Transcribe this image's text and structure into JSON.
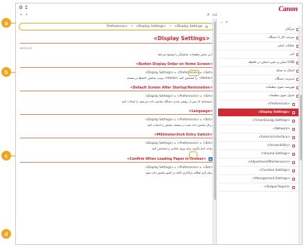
{
  "callouts": {
    "a": "a",
    "b": "b",
    "c": "c",
    "d": "d"
  },
  "toolbar": {
    "logo": "Canon",
    "doc_code": "80YY-072"
  },
  "breadcrumb": {
    "items": [
      "Preferences>",
      "<Display Settings>",
      "<Display Settings"
    ]
  },
  "page": {
    "title": "<Display Settings>",
    "intro": "این بخش تنظیمات نمایشگر را توضیح می‌دهد."
  },
  "sections": [
    {
      "head": "<Button Display Order on Home Screen>",
      "path": [
        "<Set>",
        "<Preferences>",
        "<Display Settings>"
      ],
      "body": "ترتیب نمایش دکمه‌ها در صفحه <Home> را مشخص کنید. <Home>"
    },
    {
      "head": "<Default Screen After Startup/Restoration>",
      "path": [
        "<Set>",
        "<Preferences>",
        "<Display Settings>"
      ],
      "body": "صفحه‌ای که پس از روشن شدن دستگاه نمایش داده می‌شود را انتخاب کنید."
    },
    {
      "head": "<Language>",
      "path": [
        "<Set>",
        "<Preferences>",
        "<Display Settings>"
      ],
      "body": "زبان نمایش داده شده در صفحه نمایش را انتخاب کنید."
    },
    {
      "head": "<Millimeter/Inch Entry Switch>",
      "path": [
        "<Set>",
        "<Preferences>",
        "<Display Settings>"
      ],
      "body": "واحد اندازه‌گیری برای ورود مقادیر را مشخص کنید."
    }
  ],
  "collapsible": {
    "label": "<Confirm When Loading Paper in Drawer>",
    "path": [
      "<Set>",
      "<Preferences>",
      "<Display Settings>"
    ],
    "body": "پیام تأیید هنگام بارگذاری کاغذ در کشو نمایش داده شود."
  },
  "sidebar": {
    "items": [
      {
        "label": "سرآغاز",
        "sub": false,
        "active": false
      },
      {
        "label": "سرعت کار با دستگاه",
        "sub": false,
        "active": false
      },
      {
        "label": "عملیات اصلی",
        "sub": false,
        "active": false
      },
      {
        "label": "کپی",
        "sub": false,
        "active": false
      },
      {
        "label": "اسکن و ذخیره اسکن در حافظه USB",
        "sub": false,
        "active": false
      },
      {
        "label": "اتصال به شبکه",
        "sub": false,
        "active": false
      },
      {
        "label": "مدیریت دستگاه",
        "sub": false,
        "active": false
      },
      {
        "label": "فهرست منوی تنظیمات",
        "sub": false,
        "active": false
      },
      {
        "label": "جدول منوی تنظیمات",
        "sub": false,
        "active": false
      },
      {
        "label": "<Preferences>",
        "sub": true,
        "active": false
      },
      {
        "label": "<Display Settings>",
        "sub": true,
        "active": true
      },
      {
        "label": "<Timer/Energy Settings>",
        "sub": true,
        "active": false
      },
      {
        "label": "<Network>",
        "sub": true,
        "active": false
      },
      {
        "label": "<External Interface>",
        "sub": true,
        "active": false
      },
      {
        "label": "<Accessibility>",
        "sub": true,
        "active": false
      },
      {
        "label": "<Volume Settings>",
        "sub": true,
        "active": false
      },
      {
        "label": "<Adjustment/Maintenance>",
        "sub": true,
        "active": false
      },
      {
        "label": "<Function Settings>",
        "sub": true,
        "active": false
      },
      {
        "label": "<Management Settings>",
        "sub": true,
        "active": false
      },
      {
        "label": "<Output Report>",
        "sub": true,
        "active": false
      }
    ]
  },
  "colors": {
    "accent": "#c6283a",
    "callout": "#f2a51a",
    "sidebar_active": "#cf2a34",
    "blue_button": "#4a8fd0"
  },
  "icons": [
    "gear-icon",
    "back-icon",
    "forward-icon",
    "search-icon",
    "print-icon",
    "collapse-all-icon",
    "expand-all-icon",
    "page-top-icon"
  ]
}
